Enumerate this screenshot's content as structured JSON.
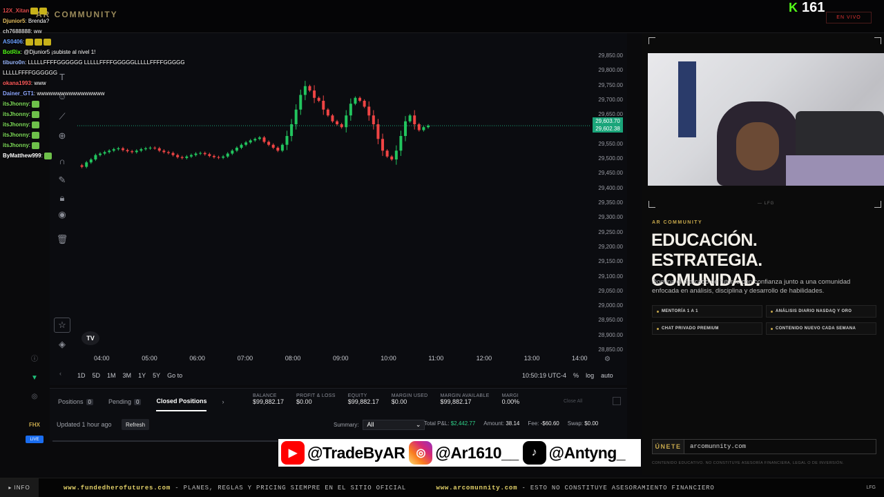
{
  "header": {
    "brand": "AR COMMUNITY",
    "viewers": "161",
    "viewers_icon": "kick-icon",
    "live_label": "EN VIVO"
  },
  "chat": [
    {
      "user": "12X_Xitan",
      "text": "",
      "color": "#e04a4a",
      "emotes": 2
    },
    {
      "user": "Djunior5",
      "text": ": Brenda?",
      "color": "#e7c060",
      "emotes": 0
    },
    {
      "user": "ch7688888",
      "text": ": ww",
      "color": "#c7c7c7",
      "emotes": 0
    },
    {
      "user": "AS0406",
      "text": ":",
      "color": "#6aa0ff",
      "emotes": 3
    },
    {
      "user": "BotRix",
      "text": ": @Djunior5 ¡subiste al nivel 1!",
      "color": "#53fc18",
      "emotes": 0
    },
    {
      "user": "tiburo0n",
      "text": ": LLLLLFFFFGGGGGG LLLLLFFFFGGGGGLLLLLFFFFGGGGG",
      "color": "#9ab8ff",
      "emotes": 0
    },
    {
      "user": "",
      "text": "LLLLLFFFFGGGGGG",
      "color": "#ffffff",
      "emotes": 0
    },
    {
      "user": "okana1993",
      "text": ": www",
      "color": "#ff5a5a",
      "emotes": 0
    },
    {
      "user": "Dainer_GT1",
      "text": ": wwwwwwwwwwwwwwwww",
      "color": "#8fa8ff",
      "emotes": 0
    },
    {
      "user": "itsJhonny",
      "text": ":",
      "color": "#7fdc5a",
      "emotes": 1
    },
    {
      "user": "itsJhonny",
      "text": ":",
      "color": "#7fdc5a",
      "emotes": 1
    },
    {
      "user": "itsJhonny",
      "text": ":",
      "color": "#7fdc5a",
      "emotes": 1
    },
    {
      "user": "itsJhonny",
      "text": ":",
      "color": "#7fdc5a",
      "emotes": 1
    },
    {
      "user": "itsJhonny",
      "text": ":",
      "color": "#7fdc5a",
      "emotes": 1
    },
    {
      "user": "ByMatthew999",
      "text": ":",
      "color": "#ffffff",
      "emotes": 1
    }
  ],
  "chart": {
    "yticks": [
      "29,850.00",
      "29,800.00",
      "29,750.00",
      "29,700.00",
      "29,650.00",
      "29,600.00",
      "29,550.00",
      "29,500.00",
      "29,450.00",
      "29,400.00",
      "29,350.00",
      "29,300.00",
      "29,250.00",
      "29,200.00",
      "29,150.00",
      "29,100.00",
      "29,050.00",
      "29,000.00",
      "28,950.00",
      "28,900.00",
      "28,850.00"
    ],
    "xticks": [
      "04:00",
      "05:00",
      "06:00",
      "07:00",
      "08:00",
      "09:00",
      "10:00",
      "11:00",
      "12:00",
      "13:00",
      "14:00"
    ],
    "price_tags": [
      "29,603.70",
      "29,602.38"
    ],
    "ranges": [
      "1D",
      "5D",
      "1M",
      "3M",
      "1Y",
      "5Y",
      "Go to"
    ],
    "clock": "10:50:19 UTC-4",
    "scale_opts": [
      "%",
      "log",
      "auto"
    ],
    "tv_logo": "TV"
  },
  "chart_data": {
    "type": "candlestick",
    "x_start": "03:40",
    "x_end": "10:50",
    "ylim": [
      28850,
      29850
    ],
    "path_y": [
      29470,
      29465,
      29480,
      29490,
      29505,
      29510,
      29515,
      29520,
      29525,
      29528,
      29522,
      29518,
      29515,
      29520,
      29525,
      29528,
      29530,
      29528,
      29520,
      29515,
      29512,
      29505,
      29498,
      29495,
      29500,
      29505,
      29510,
      29512,
      29508,
      29502,
      29498,
      29496,
      29500,
      29510,
      29520,
      29530,
      29540,
      29548,
      29555,
      29560,
      29565,
      29550,
      29540,
      29530,
      29520,
      29540,
      29570,
      29610,
      29660,
      29710,
      29740,
      29725,
      29700,
      29690,
      29660,
      29640,
      29620,
      29610,
      29600,
      29640,
      29680,
      29700,
      29690,
      29670,
      29640,
      29610,
      29560,
      29520,
      29500,
      29490,
      29520,
      29570,
      29620,
      29640,
      29610,
      29590,
      29600,
      29605
    ]
  },
  "positions": {
    "tabs": [
      {
        "label": "Positions",
        "count": "0"
      },
      {
        "label": "Pending",
        "count": "0"
      },
      {
        "label": "Closed Positions",
        "count": ""
      }
    ],
    "metrics": [
      {
        "label": "BALANCE",
        "value": "$99,882.17"
      },
      {
        "label": "PROFIT & LOSS",
        "value": "$0.00"
      },
      {
        "label": "EQUITY",
        "value": "$99,882.17"
      },
      {
        "label": "MARGIN USED",
        "value": "$0.00"
      },
      {
        "label": "MARGIN AVAILABLE",
        "value": "$99,882.17"
      },
      {
        "label": "MARGI",
        "value": "0.00%"
      }
    ],
    "close_all": "Close All",
    "updated": "Updated 1 hour ago",
    "refresh": "Refresh",
    "summary_label": "Summary:",
    "summary_value": "All",
    "total_pnl_label": "Total P&L:",
    "total_pnl": "$2,442.77",
    "amount_label": "Amount:",
    "amount": "38.14",
    "fee_label": "Fee:",
    "fee": "-$60.60",
    "swap_label": "Swap:",
    "swap": "$0.00"
  },
  "socials": [
    {
      "icon": "youtube-icon",
      "handle": "@TradeByAR",
      "color": "#ff0000"
    },
    {
      "icon": "instagram-icon",
      "handle": "@Ar1610__",
      "color": "#d62976"
    },
    {
      "icon": "tiktok-icon",
      "handle": "@Antyng_",
      "color": "#000000"
    }
  ],
  "promo": {
    "tag_top": "— LFG",
    "small": "AR COMMUNITY",
    "headline_1": "EDUCACIÓN. ESTRATEGIA.",
    "headline_2": "COMUNIDAD.",
    "description": "Domina el mercado de futuros con confianza junto a una comunidad enfocada en análisis, disciplina y desarrollo de habilidades.",
    "features": [
      "MENTORÍA 1 A 1",
      "ANÁLISIS DIARIO NASDAQ Y ORO",
      "CHAT PRIVADO PREMIUM",
      "CONTENIDO NUEVO CADA SEMANA"
    ],
    "join_label": "ÚNETE",
    "join_url": "arcomunnity.com",
    "disclaimer": "CONTENIDO EDUCATIVO. NO CONSTITUYE ASESORÍA FINANCIERA, LEGAL O DE INVERSIÓN."
  },
  "ticker": {
    "info": "▸ INFO",
    "site1": "www.fundedherofutures.com",
    "msg1": "- PLANES, REGLAS Y PRICING SIEMPRE EN EL SITIO OFICIAL",
    "site2": "www.arcomunnity.com",
    "msg2": "- ESTO NO CONSTITUYE ASESORAMIENTO FINANCIERO",
    "end": "LFG"
  },
  "left_logos": {
    "fhx": "FHX",
    "live": "LIVE"
  },
  "colors": {
    "up": "#22c55e",
    "down": "#ef4444",
    "accent": "#c8a94c",
    "kick": "#53fc18"
  }
}
